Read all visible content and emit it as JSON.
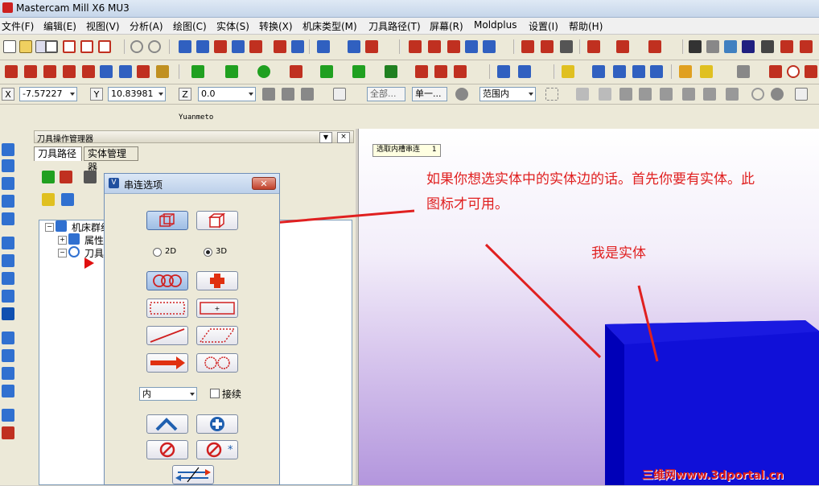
{
  "window": {
    "title": "Mastercam Mill X6 MU3"
  },
  "menu": [
    "文件(F)",
    "编辑(E)",
    "视图(V)",
    "分析(A)",
    "绘图(C)",
    "实体(S)",
    "转换(X)",
    "机床类型(M)",
    "刀具路径(T)",
    "屏幕(R)",
    "Moldplus",
    "设置(I)",
    "帮助(H)"
  ],
  "coords": {
    "x_label": "X",
    "x_value": "-7.57227",
    "y_label": "Y",
    "y_value": "10.83981",
    "z_label": "Z",
    "z_value": "0.0",
    "filter_all": "全部...",
    "filter_single": "单一...",
    "range_mode": "范围内"
  },
  "hint": "Yuanmeto",
  "manager": {
    "title": "刀具操作管理器",
    "tab_toolpaths": "刀具路径",
    "tab_solids": "实体管理器",
    "tree_machine_group": "机床群组",
    "tree_properties": "属性",
    "tree_toolpath_group": "刀具"
  },
  "graphics": {
    "prompt_tip": "选取内槽串连",
    "prompt_count": "1",
    "annotation_1": "如果你想选实体中的实体边的话。首先你要有实体。此图标才可用。",
    "annotation_2": "我是实体",
    "watermark": "三维网www.3dportal.cn"
  },
  "chain_dialog": {
    "title": "串连选项",
    "radio_2d": "2D",
    "radio_3d": "3D",
    "selected_mode": "3D",
    "dropdown_value": "内",
    "checkbox_label": "接续",
    "checkbox_checked": false
  },
  "colors": {
    "annotation_red": "#e02020",
    "solid_blue": "#1010d8",
    "solid_blue_dark": "#0000b8"
  }
}
